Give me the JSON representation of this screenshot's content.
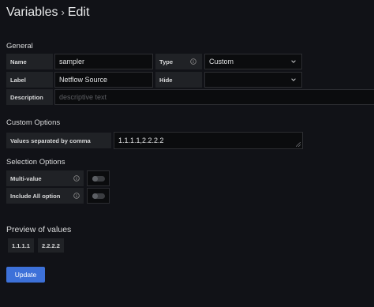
{
  "header": {
    "title": "Variables",
    "separator": "›",
    "subtitle": "Edit"
  },
  "general": {
    "heading": "General",
    "name_label": "Name",
    "name_value": "sampler",
    "type_label": "Type",
    "type_value": "Custom",
    "label_label": "Label",
    "label_value": "Netflow Source",
    "hide_label": "Hide",
    "hide_value": "",
    "description_label": "Description",
    "description_placeholder": "descriptive text"
  },
  "custom_options": {
    "heading": "Custom Options",
    "values_label": "Values separated by comma",
    "values_value": "1.1.1.1,2.2.2.2"
  },
  "selection_options": {
    "heading": "Selection Options",
    "multi_value_label": "Multi-value",
    "include_all_label": "Include All option"
  },
  "preview": {
    "heading": "Preview of values",
    "values": [
      "1.1.1.1",
      "2.2.2.2"
    ]
  },
  "actions": {
    "update_label": "Update"
  },
  "colors": {
    "background": "#111217",
    "primary_button": "#3d71d9",
    "label_bg": "#202226",
    "input_bg": "#0b0c0e"
  },
  "icons": [
    "info-icon",
    "chevron-down-icon",
    "resize-handle-icon"
  ]
}
